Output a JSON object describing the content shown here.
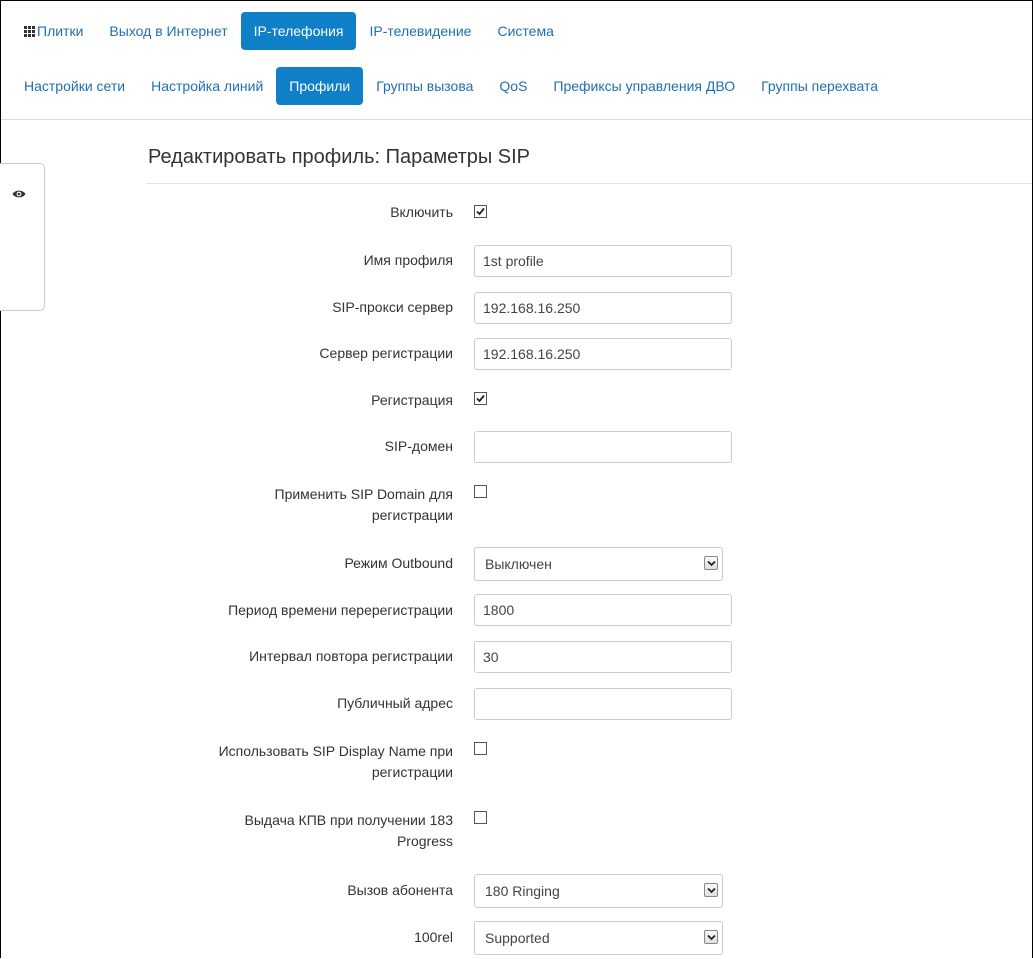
{
  "nav_top": {
    "tiles_label": "Плитки",
    "internet": "Выход в Интернет",
    "ip_telephony": "IP-телефония",
    "ip_tv": "IP-телевидение",
    "system": "Система"
  },
  "nav_sub": {
    "network": "Настройки сети",
    "lines": "Настройка линий",
    "profiles": "Профили",
    "call_groups": "Группы вызова",
    "qos": "QoS",
    "prefixes": "Префиксы управления ДВО",
    "pickup_groups": "Группы перехвата"
  },
  "page_title": "Редактировать профиль: Параметры SIP",
  "form": {
    "enable": {
      "label": "Включить",
      "checked": true
    },
    "profile_name": {
      "label": "Имя профиля",
      "value": "1st profile"
    },
    "sip_proxy": {
      "label": "SIP-прокси сервер",
      "value": "192.168.16.250"
    },
    "registrar": {
      "label": "Сервер регистрации",
      "value": "192.168.16.250"
    },
    "registration": {
      "label": "Регистрация",
      "checked": true
    },
    "sip_domain": {
      "label": "SIP-домен",
      "value": ""
    },
    "apply_domain": {
      "label_line1": "Применить SIP Domain для",
      "label_line2": "регистрации",
      "checked": false
    },
    "outbound": {
      "label": "Режим Outbound",
      "value": "Выключен"
    },
    "rereg_period": {
      "label": "Период времени перерегистрации",
      "value": "1800"
    },
    "retry_interval": {
      "label": "Интервал повтора регистрации",
      "value": "30"
    },
    "public_address": {
      "label": "Публичный адрес",
      "value": ""
    },
    "display_name": {
      "label_line1": "Использовать SIP Display Name при",
      "label_line2": "регистрации",
      "checked": false
    },
    "kpv": {
      "label_line1": "Выдача КПВ при получении 183",
      "label_line2": "Progress",
      "checked": false
    },
    "subscriber_call": {
      "label": "Вызов абонента",
      "value": "180 Ringing"
    },
    "rel100": {
      "label": "100rel",
      "value": "Supported"
    }
  }
}
